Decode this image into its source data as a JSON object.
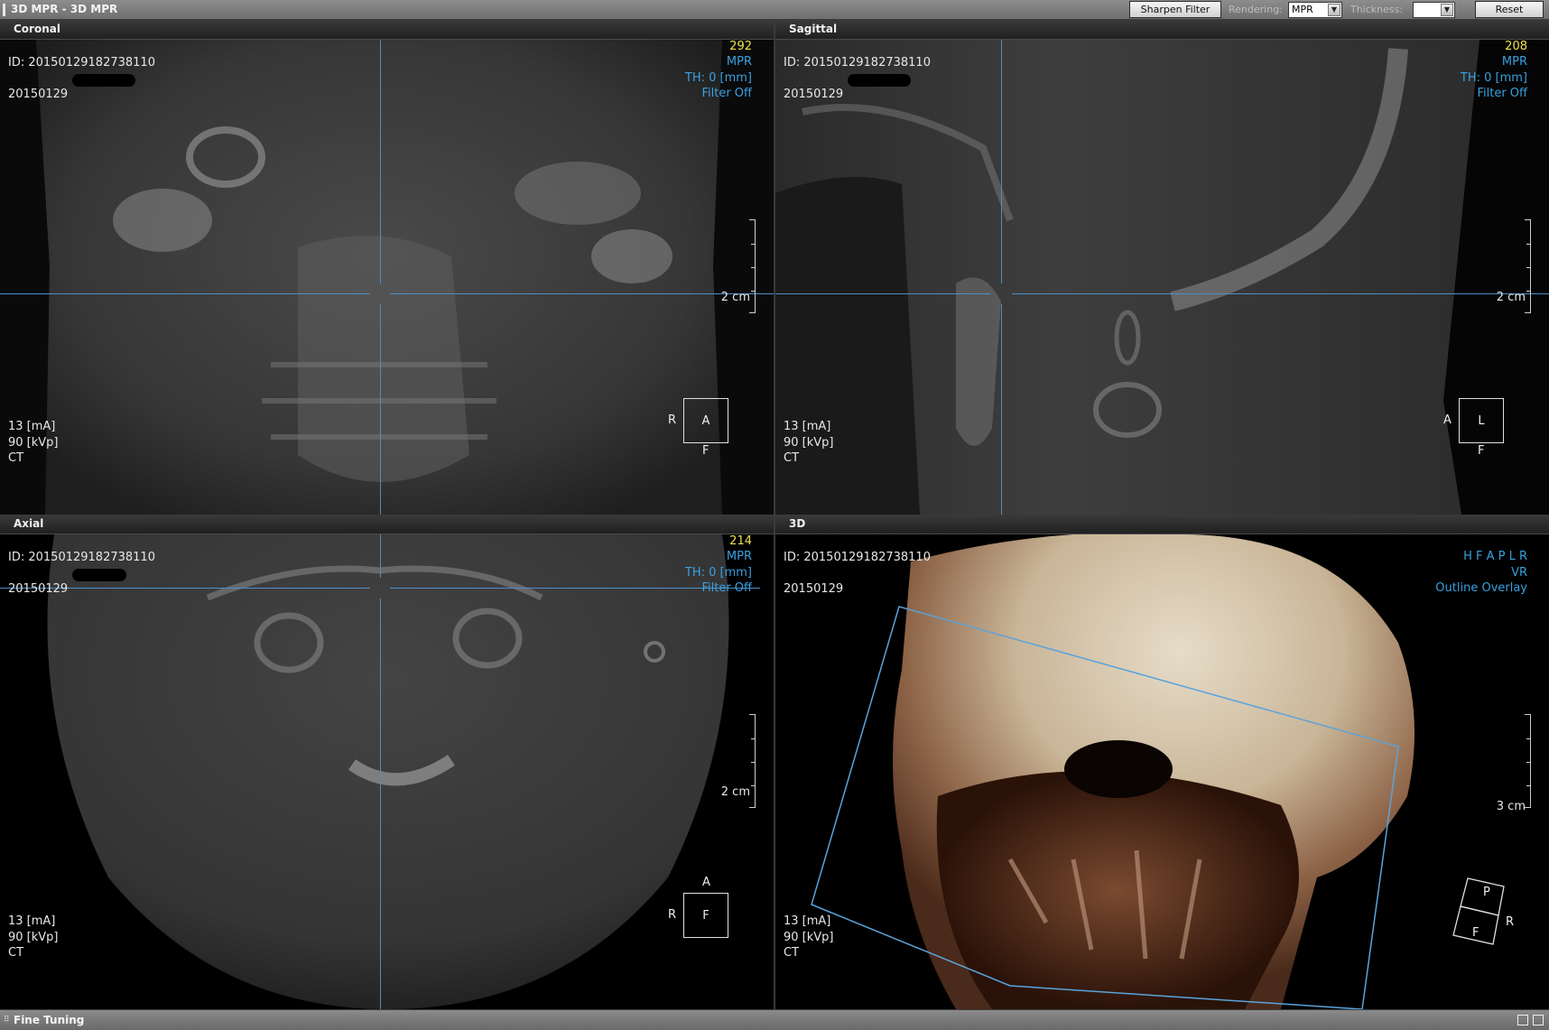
{
  "window": {
    "title": "3D MPR - 3D MPR"
  },
  "toolbar": {
    "sharpen_label": "Sharpen Filter",
    "rendering_label": "Rendering:",
    "rendering_value": "MPR",
    "thickness_label": "Thickness:",
    "thickness_value": "",
    "reset_label": "Reset"
  },
  "viewports": {
    "coronal": {
      "title": "Coronal",
      "id": "ID: 20150129182738110",
      "date": "20150129",
      "slice": "292",
      "mode": "MPR",
      "th": "TH: 0 [mm]",
      "filter": "Filter Off",
      "scale": "2 cm",
      "ma": "13 [mA]",
      "kvp": "90 [kVp]",
      "modality": "CT",
      "orient_center": "A",
      "orient_left": "R",
      "orient_bottom": "F"
    },
    "sagittal": {
      "title": "Sagittal",
      "id": "ID: 20150129182738110",
      "date": "20150129",
      "slice": "208",
      "mode": "MPR",
      "th": "TH: 0 [mm]",
      "filter": "Filter Off",
      "scale": "2 cm",
      "ma": "13 [mA]",
      "kvp": "90 [kVp]",
      "modality": "CT",
      "orient_center": "L",
      "orient_left": "A",
      "orient_bottom": "F"
    },
    "axial": {
      "title": "Axial",
      "id": "ID: 20150129182738110",
      "date": "20150129",
      "slice": "214",
      "mode": "MPR",
      "th": "TH: 0 [mm]",
      "filter": "Filter Off",
      "scale": "2 cm",
      "ma": "13 [mA]",
      "kvp": "90 [kVp]",
      "modality": "CT",
      "orient_center": "F",
      "orient_left": "R",
      "orient_top": "A"
    },
    "threed": {
      "title": "3D",
      "id": "ID: 20150129182738110",
      "date": "20150129",
      "dirs": "H F A P L R",
      "mode": "VR",
      "overlay": "Outline Overlay",
      "scale": "3 cm",
      "ma": "13 [mA]",
      "kvp": "90 [kVp]",
      "modality": "CT",
      "cube_top": "P",
      "cube_front": "F",
      "cube_side": "R"
    }
  },
  "bottombar": {
    "label": "Fine Tuning"
  }
}
